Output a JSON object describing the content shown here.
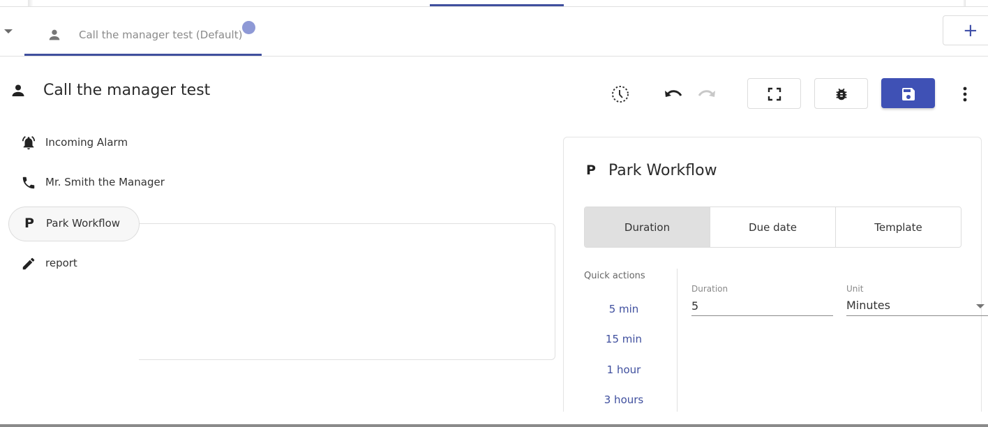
{
  "tabs": {
    "items": [
      {
        "label": "Call the manager test (Default)",
        "icon": "person-icon",
        "active": true,
        "unsaved_indicator": true
      }
    ],
    "add_label": "+"
  },
  "header": {
    "title": "Call the manager test",
    "icon": "person-icon",
    "toolbar": {
      "history": "history-icon",
      "undo": "undo-icon",
      "redo": "redo-icon",
      "redo_enabled": false,
      "fullscreen": "fullscreen-icon",
      "debug": "bug-icon",
      "save": "save-icon",
      "more": "more-vert-icon"
    }
  },
  "workflow": {
    "steps": [
      {
        "label": "Incoming Alarm",
        "icon": "alarm-bell-icon",
        "selected": false
      },
      {
        "label": "Mr. Smith the Manager",
        "icon": "phone-icon",
        "selected": false
      },
      {
        "label": "Park Workflow",
        "icon": "park-p-icon",
        "icon_text": "P",
        "selected": true
      },
      {
        "label": "report",
        "icon": "pencil-icon",
        "selected": false
      }
    ]
  },
  "panel": {
    "icon_text": "P",
    "title": "Park Workflow",
    "modes": [
      {
        "label": "Duration",
        "active": true
      },
      {
        "label": "Due date",
        "active": false
      },
      {
        "label": "Template",
        "active": false
      }
    ],
    "quick_actions": {
      "title": "Quick actions",
      "items": [
        "5 min",
        "15 min",
        "1 hour",
        "3 hours"
      ]
    },
    "duration": {
      "label": "Duration",
      "value": "5"
    },
    "unit": {
      "label": "Unit",
      "value": "Minutes"
    }
  },
  "colors": {
    "accent": "#3f51b5",
    "tab_underline": "#3f4f9e",
    "unsaved_dot": "#8e99d6",
    "link": "#3f4f9e"
  }
}
